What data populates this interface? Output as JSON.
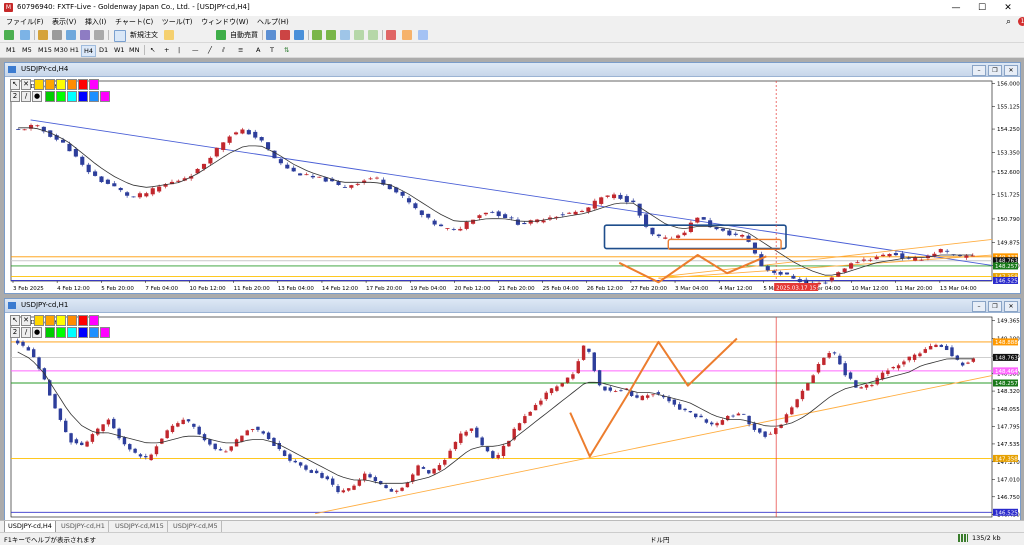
{
  "window": {
    "title": "60796940: FXTF-Live - Goldenway Japan Co., Ltd. - [USDJPY-cd,H4]",
    "controls": [
      "—",
      "☐",
      "✕"
    ]
  },
  "menu": [
    "ファイル(F)",
    "表示(V)",
    "挿入(I)",
    "チャート(C)",
    "ツール(T)",
    "ウィンドウ(W)",
    "ヘルプ(H)"
  ],
  "toolbar": {
    "new_order": "新規注文",
    "auto_trade": "自動売買"
  },
  "timeframes": [
    "M1",
    "M5",
    "M15",
    "M30",
    "H1",
    "H4",
    "D1",
    "W1",
    "MN"
  ],
  "active_timeframe": "H4",
  "charts": [
    {
      "title": "USDJPY-cd,H4",
      "legend": "USDJPY-cd,H4",
      "chart_data": {
        "type": "candlestick",
        "symbol": "USDJPY-cd",
        "timeframe": "H4",
        "price_ticks": [
          "156.000",
          "155.125",
          "154.250",
          "153.350",
          "152.600",
          "151.725",
          "150.790",
          "149.875",
          "149.000"
        ],
        "ylim": [
          148.4,
          156.1
        ],
        "time_labels": [
          "3 Feb 2025",
          "4 Feb 12:00",
          "5 Feb 20:00",
          "7 Feb 04:00",
          "10 Feb 12:00",
          "11 Feb 20:00",
          "13 Feb 04:00",
          "14 Feb 12:00",
          "17 Feb 20:00",
          "19 Feb 04:00",
          "20 Feb 12:00",
          "21 Feb 20:00",
          "25 Feb 04:00",
          "26 Feb 12:00",
          "27 Feb 20:00",
          "3 Mar 04:00",
          "4 Mar 12:00",
          "5 Mar 20:00",
          "7 Mar 04:00",
          "10 Mar 12:00",
          "11 Mar 20:00",
          "13 Mar 04:00"
        ],
        "cursor_time": "2025.03.17 15:00",
        "close_path": [
          154.2,
          154.4,
          154.0,
          153.6,
          152.8,
          152.3,
          152.0,
          151.6,
          151.8,
          152.1,
          152.3,
          152.6,
          153.3,
          154.0,
          154.2,
          153.8,
          153.0,
          152.6,
          152.4,
          152.3,
          152.0,
          152.2,
          152.4,
          152.0,
          151.5,
          150.9,
          150.5,
          150.3,
          150.8,
          151.1,
          150.9,
          150.6,
          150.7,
          150.9,
          151.0,
          151.1,
          151.6,
          151.7,
          151.4,
          150.2,
          150.0,
          150.2,
          150.9,
          150.4,
          150.2,
          150.1,
          148.9,
          148.7,
          148.5,
          148.2,
          148.4,
          148.9,
          149.2,
          149.3,
          149.5,
          149.2,
          149.3,
          149.6,
          149.3,
          149.4
        ],
        "ma_path": [
          154.3,
          154.3,
          154.1,
          153.8,
          153.3,
          152.8,
          152.4,
          152.1,
          152.0,
          152.1,
          152.2,
          152.5,
          152.9,
          153.3,
          153.6,
          153.6,
          153.3,
          152.9,
          152.6,
          152.4,
          152.2,
          152.2,
          152.2,
          152.1,
          151.8,
          151.4,
          151.0,
          150.7,
          150.7,
          150.8,
          150.8,
          150.7,
          150.7,
          150.8,
          150.9,
          151.0,
          151.2,
          151.4,
          151.4,
          151.0,
          150.6,
          150.4,
          150.5,
          150.5,
          150.4,
          150.3,
          149.9,
          149.5,
          149.1,
          148.8,
          148.6,
          148.7,
          148.9,
          149.1,
          149.2,
          149.3,
          149.3,
          149.4,
          149.4,
          149.4
        ],
        "hlines": [
          {
            "price": 149.33,
            "color": "#ff9900",
            "tag": "149.333"
          },
          {
            "price": 149.18,
            "color": "#c8c8c8",
            "tag": "148.763"
          },
          {
            "price": 148.98,
            "color": "#2a9b2a",
            "tag": "148.257"
          },
          {
            "price": 148.57,
            "color": "#ffc000",
            "tag": "147.358"
          },
          {
            "price": 148.42,
            "color": "#3333cc",
            "tag": "146.525"
          }
        ],
        "price_tags": [
          "149.333",
          "148.763",
          "148.257",
          "147.358",
          "146.525"
        ],
        "price_tag_colors": [
          "#ff9900",
          "#111111",
          "#1a7a1a",
          "#e6a000",
          "#2a2acc"
        ]
      }
    },
    {
      "title": "USDJPY-cd,H1",
      "legend": "USDJPY-cd,H1",
      "chart_data": {
        "type": "candlestick",
        "symbol": "USDJPY-cd",
        "timeframe": "H1",
        "price_ticks": [
          "149.365",
          "149.100",
          "148.840",
          "148.580",
          "148.320",
          "148.055",
          "147.795",
          "147.535",
          "147.270",
          "147.010",
          "146.750",
          "146.490"
        ],
        "ylim": [
          146.45,
          149.42
        ],
        "close_path": [
          149.05,
          148.9,
          148.5,
          148.0,
          147.6,
          147.5,
          147.7,
          147.9,
          147.6,
          147.4,
          147.3,
          147.6,
          147.8,
          147.9,
          147.7,
          147.5,
          147.4,
          147.6,
          147.8,
          147.7,
          147.5,
          147.3,
          147.2,
          147.1,
          147.0,
          146.8,
          146.9,
          147.1,
          146.95,
          146.8,
          146.9,
          147.2,
          147.1,
          147.3,
          147.6,
          147.8,
          147.5,
          147.3,
          147.6,
          147.9,
          148.1,
          148.3,
          148.4,
          148.6,
          149.05,
          148.4,
          148.3,
          148.35,
          148.2,
          148.3,
          148.25,
          148.1,
          148.0,
          147.9,
          147.8,
          147.95,
          148.0,
          147.75,
          147.65,
          147.8,
          148.1,
          148.4,
          148.7,
          148.95,
          148.6,
          148.35,
          148.4,
          148.6,
          148.7,
          148.8,
          148.9,
          149.0,
          148.95,
          148.7,
          148.8
        ],
        "ma_path": [
          148.9,
          148.8,
          148.6,
          148.3,
          148.0,
          147.8,
          147.7,
          147.7,
          147.65,
          147.6,
          147.55,
          147.55,
          147.6,
          147.65,
          147.65,
          147.6,
          147.55,
          147.55,
          147.6,
          147.6,
          147.55,
          147.45,
          147.35,
          147.25,
          147.15,
          147.05,
          147.0,
          147.0,
          146.95,
          146.95,
          146.95,
          147.0,
          147.05,
          147.15,
          147.3,
          147.45,
          147.5,
          147.5,
          147.55,
          147.7,
          147.85,
          148.0,
          148.15,
          148.3,
          148.45,
          148.45,
          148.4,
          148.35,
          148.3,
          148.3,
          148.25,
          148.2,
          148.15,
          148.05,
          147.95,
          147.9,
          147.9,
          147.85,
          147.8,
          147.8,
          147.85,
          147.95,
          148.1,
          148.25,
          148.35,
          148.4,
          148.45,
          148.5,
          148.55,
          148.6,
          148.7,
          148.75,
          148.8,
          148.8,
          148.8
        ],
        "hlines": [
          {
            "price": 149.05,
            "color": "#ff9900",
            "tag": "148.888"
          },
          {
            "price": 148.82,
            "color": "#c8c8c8",
            "tag": "148.763"
          },
          {
            "price": 148.62,
            "color": "#ff66ff",
            "tag": "148.464"
          },
          {
            "price": 148.44,
            "color": "#2a9b2a",
            "tag": "148.257"
          },
          {
            "price": 147.32,
            "color": "#ffc000",
            "tag": "147.358"
          },
          {
            "price": 146.52,
            "color": "#3333cc",
            "tag": "146.525"
          }
        ],
        "price_tags": [
          "148.888",
          "148.763",
          "148.464",
          "148.257",
          "147.358",
          "146.525"
        ],
        "price_tag_colors": [
          "#ff9900",
          "#111111",
          "#ff66ff",
          "#1a7a1a",
          "#e6a000",
          "#2a2acc"
        ]
      }
    }
  ],
  "tabs": [
    "USDJPY-cd,H4",
    "USDJPY-cd,H1",
    "USDJPY-cd,M15",
    "USDJPY-cd,M5"
  ],
  "active_tab": "USDJPY-cd,H4",
  "status": {
    "help": "F1キーでヘルプが表示されます",
    "center": "ドル円",
    "traffic": "135/2 kb"
  },
  "colors": {
    "bull": "#c1272d",
    "bear": "#2d3e9b",
    "ma": "#333333",
    "trend_blue": "#4a5fd6",
    "trend_orange": "#ffae42",
    "pattern": "#ec7d2e",
    "box": "#1f4e8c",
    "cursor": "#e53935"
  }
}
